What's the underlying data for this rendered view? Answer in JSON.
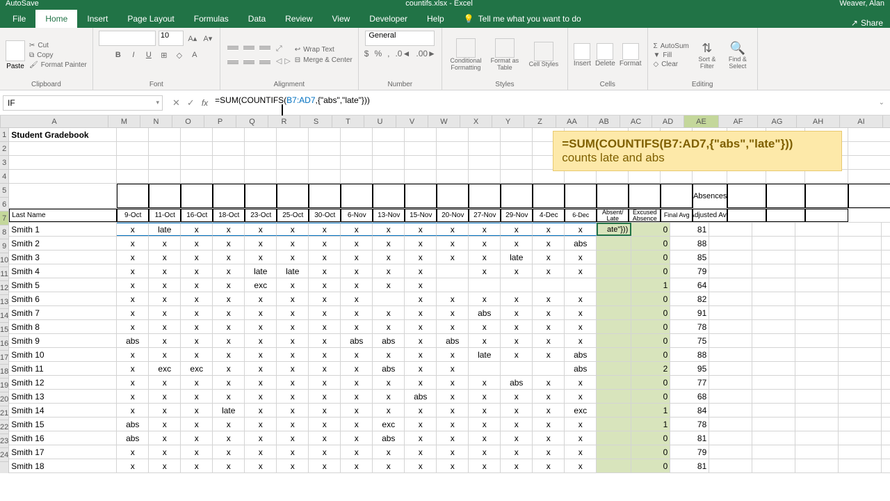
{
  "title_bar": {
    "filename": "countifs.xlsx - Excel",
    "user": "Weaver, Alan",
    "autosave": "AutoSave"
  },
  "tabs": [
    "File",
    "Home",
    "Insert",
    "Page Layout",
    "Formulas",
    "Data",
    "Review",
    "View",
    "Developer",
    "Help"
  ],
  "tellme": "Tell me what you want to do",
  "share": "Share",
  "clipboard": {
    "label": "Clipboard",
    "paste": "Paste",
    "cut": "Cut",
    "copy": "Copy",
    "fmt": "Format Painter"
  },
  "font": {
    "label": "Font",
    "size": "10"
  },
  "alignment": {
    "label": "Alignment",
    "wrap": "Wrap Text",
    "merge": "Merge & Center"
  },
  "number": {
    "label": "Number",
    "format": "General"
  },
  "styles": {
    "label": "Styles",
    "cf": "Conditional Formatting",
    "fat": "Format as Table",
    "cs": "Cell Styles"
  },
  "cells": {
    "label": "Cells",
    "ins": "Insert",
    "del": "Delete",
    "fmt": "Format"
  },
  "editing": {
    "label": "Editing",
    "sum": "AutoSum",
    "fill": "Fill",
    "clear": "Clear",
    "sort": "Sort & Filter",
    "find": "Find & Select"
  },
  "name_box": "IF",
  "formula_prefix": "=SUM(COUNTIFS(",
  "formula_ref": "B7:AD7",
  "formula_suffix": ",{\"abs\",\"late\"}))",
  "callout_line1": "=SUM(COUNTIFS(B7:AD7,{\"abs\",\"late\"}))",
  "callout_line2": "counts late and abs",
  "cols": [
    "A",
    "M",
    "N",
    "O",
    "P",
    "Q",
    "R",
    "S",
    "T",
    "U",
    "V",
    "W",
    "X",
    "Y",
    "Z",
    "AA",
    "AB",
    "AC",
    "AD",
    "AE",
    "AF",
    "AG",
    "AH",
    "AI",
    "AJ",
    "AK"
  ],
  "row_nums": [
    1,
    2,
    3,
    4,
    5,
    6,
    7,
    8,
    9,
    10,
    11,
    12,
    13,
    14,
    15,
    16,
    17,
    18,
    19,
    20,
    21,
    22,
    23,
    24
  ],
  "page_title": "Student Gradebook",
  "hdr_absences": "Absences",
  "hdr_row": [
    "Last Name",
    "9-Oct",
    "11-Oct",
    "16-Oct",
    "18-Oct",
    "23-Oct",
    "25-Oct",
    "30-Oct",
    "6-Nov",
    "13-Nov",
    "15-Nov",
    "20-Nov",
    "27-Nov",
    "29-Nov",
    "4-Dec",
    "6-Dec",
    "Absent/ Late",
    "Excused Absence",
    "Final Avg",
    "Adjusted Avg"
  ],
  "editing_cell": "ate\"}))",
  "data_rows": [
    {
      "name": "Smith 1",
      "att": [
        "x",
        "late",
        "x",
        "x",
        "x",
        "x",
        "x",
        "x",
        "x",
        "x",
        "x",
        "x",
        "x",
        "x",
        "x"
      ],
      "ae": "",
      "af": 0,
      "ag": 81
    },
    {
      "name": "Smith 2",
      "att": [
        "x",
        "x",
        "x",
        "x",
        "x",
        "x",
        "x",
        "x",
        "x",
        "x",
        "x",
        "x",
        "x",
        "x",
        "abs"
      ],
      "ae": "",
      "af": 0,
      "ag": 88
    },
    {
      "name": "Smith 3",
      "att": [
        "x",
        "x",
        "x",
        "x",
        "x",
        "x",
        "x",
        "x",
        "x",
        "x",
        "x",
        "x",
        "late",
        "x",
        "x"
      ],
      "ae": "",
      "af": 0,
      "ag": 85
    },
    {
      "name": "Smith 4",
      "att": [
        "x",
        "x",
        "x",
        "x",
        "late",
        "late",
        "x",
        "x",
        "x",
        "x",
        "",
        "x",
        "x",
        "x",
        "x"
      ],
      "ae": "",
      "af": 0,
      "ag": 79
    },
    {
      "name": "Smith 5",
      "att": [
        "x",
        "x",
        "x",
        "x",
        "exc",
        "x",
        "x",
        "x",
        "x",
        "x",
        "",
        "",
        "",
        "",
        ""
      ],
      "ae": "",
      "af": 1,
      "ag": 64
    },
    {
      "name": "Smith 6",
      "att": [
        "x",
        "x",
        "x",
        "x",
        "x",
        "x",
        "x",
        "x",
        "",
        "x",
        "x",
        "x",
        "x",
        "x",
        "x"
      ],
      "ae": "",
      "af": 0,
      "ag": 82
    },
    {
      "name": "Smith 7",
      "att": [
        "x",
        "x",
        "x",
        "x",
        "x",
        "x",
        "x",
        "x",
        "x",
        "x",
        "x",
        "abs",
        "x",
        "x",
        "x"
      ],
      "ae": "",
      "af": 0,
      "ag": 91
    },
    {
      "name": "Smith 8",
      "att": [
        "x",
        "x",
        "x",
        "x",
        "x",
        "x",
        "x",
        "x",
        "x",
        "x",
        "x",
        "x",
        "x",
        "x",
        "x"
      ],
      "ae": "",
      "af": 0,
      "ag": 78
    },
    {
      "name": "Smith 9",
      "att": [
        "abs",
        "x",
        "x",
        "x",
        "x",
        "x",
        "x",
        "abs",
        "abs",
        "x",
        "abs",
        "x",
        "x",
        "x",
        "x"
      ],
      "ae": "",
      "af": 0,
      "ag": 75
    },
    {
      "name": "Smith 10",
      "att": [
        "x",
        "x",
        "x",
        "x",
        "x",
        "x",
        "x",
        "x",
        "x",
        "x",
        "x",
        "late",
        "x",
        "x",
        "abs"
      ],
      "ae": "",
      "af": 0,
      "ag": 88
    },
    {
      "name": "Smith 11",
      "att": [
        "x",
        "exc",
        "exc",
        "x",
        "x",
        "x",
        "x",
        "x",
        "abs",
        "x",
        "x",
        "",
        "",
        "",
        "abs"
      ],
      "ae": "",
      "af": 2,
      "ag": 95
    },
    {
      "name": "Smith 12",
      "att": [
        "x",
        "x",
        "x",
        "x",
        "x",
        "x",
        "x",
        "x",
        "x",
        "x",
        "x",
        "x",
        "abs",
        "x",
        "x"
      ],
      "ae": "",
      "af": 0,
      "ag": 77
    },
    {
      "name": "Smith 13",
      "att": [
        "x",
        "x",
        "x",
        "x",
        "x",
        "x",
        "x",
        "x",
        "x",
        "abs",
        "x",
        "x",
        "x",
        "x",
        "x"
      ],
      "ae": "",
      "af": 0,
      "ag": 68
    },
    {
      "name": "Smith 14",
      "att": [
        "x",
        "x",
        "x",
        "late",
        "x",
        "x",
        "x",
        "x",
        "x",
        "x",
        "x",
        "x",
        "x",
        "x",
        "exc"
      ],
      "ae": "",
      "af": 1,
      "ag": 84
    },
    {
      "name": "Smith 15",
      "att": [
        "abs",
        "x",
        "x",
        "x",
        "x",
        "x",
        "x",
        "x",
        "exc",
        "x",
        "x",
        "x",
        "x",
        "x",
        "x"
      ],
      "ae": "",
      "af": 1,
      "ag": 78
    },
    {
      "name": "Smith 16",
      "att": [
        "abs",
        "x",
        "x",
        "x",
        "x",
        "x",
        "x",
        "x",
        "abs",
        "x",
        "x",
        "x",
        "x",
        "x",
        "x"
      ],
      "ae": "",
      "af": 0,
      "ag": 81
    },
    {
      "name": "Smith 17",
      "att": [
        "x",
        "x",
        "x",
        "x",
        "x",
        "x",
        "x",
        "x",
        "x",
        "x",
        "x",
        "x",
        "x",
        "x",
        "x"
      ],
      "ae": "",
      "af": 0,
      "ag": 79
    },
    {
      "name": "Smith 18",
      "att": [
        "x",
        "x",
        "x",
        "x",
        "x",
        "x",
        "x",
        "x",
        "x",
        "x",
        "x",
        "x",
        "x",
        "x",
        "x"
      ],
      "ae": "",
      "af": 0,
      "ag": 81
    }
  ],
  "col_widths_att": 46
}
